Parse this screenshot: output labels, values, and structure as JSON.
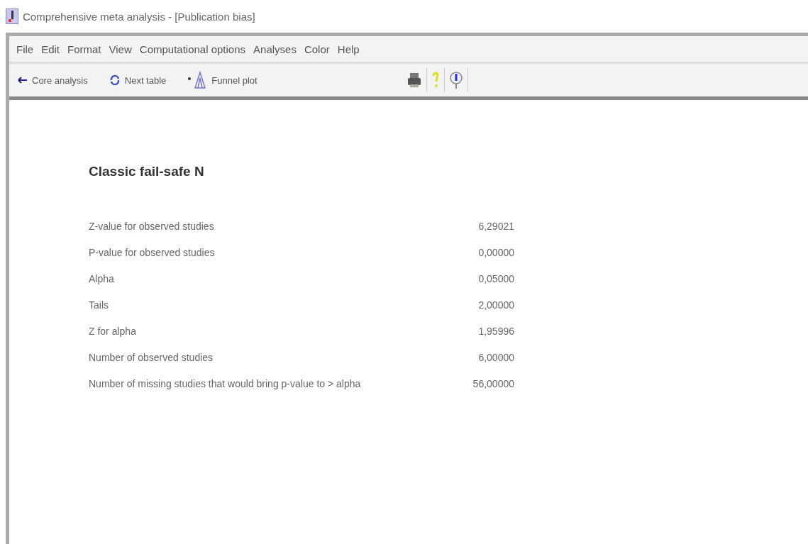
{
  "window": {
    "title": "Comprehensive meta analysis - [Publication bias]"
  },
  "menu": [
    "File",
    "Edit",
    "Format",
    "View",
    "Computational options",
    "Analyses",
    "Color",
    "Help"
  ],
  "toolbar": [
    {
      "kind": "back",
      "label": "Core analysis"
    },
    {
      "kind": "next",
      "label": "Next table"
    },
    {
      "kind": "funnel",
      "label": "Funnel plot"
    },
    {
      "kind": "print"
    },
    {
      "kind": "help"
    },
    {
      "kind": "info"
    }
  ],
  "report": {
    "heading": "Classic fail-safe N",
    "rows": [
      {
        "label": "Z-value for observed studies",
        "value": "6,29021"
      },
      {
        "label": "P-value for observed studies",
        "value": "0,00000"
      },
      {
        "label": "Alpha",
        "value": "0,05000"
      },
      {
        "label": "Tails",
        "value": "2,00000"
      },
      {
        "label": "Z for alpha",
        "value": "1,95996"
      },
      {
        "label": "Number of observed studies",
        "value": "6,00000"
      },
      {
        "label": "Number of missing studies that would bring p-value to > alpha",
        "value": "56,00000"
      }
    ]
  }
}
